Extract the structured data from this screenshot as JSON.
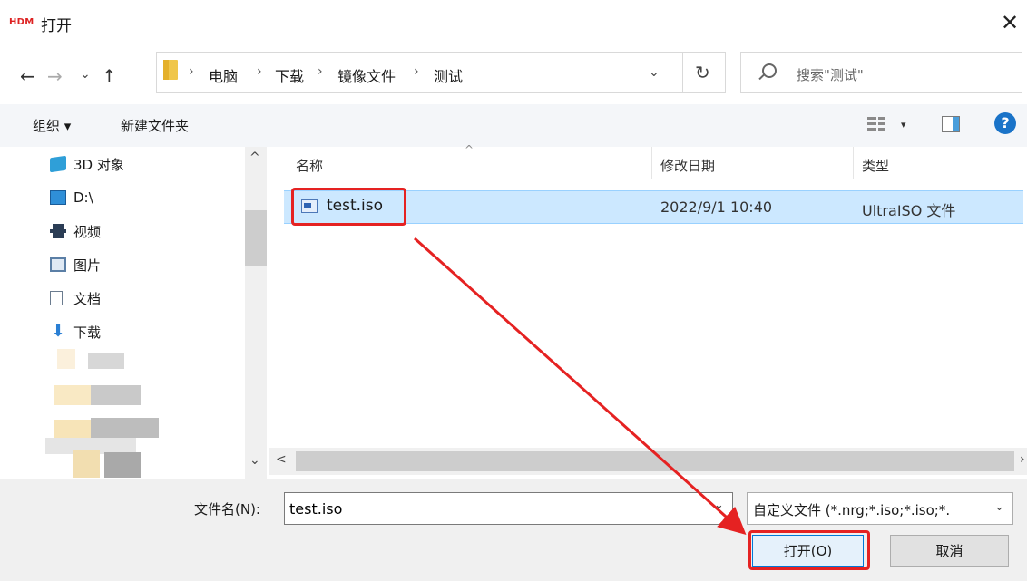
{
  "title_bar": {
    "logo_text": "HDM",
    "title": "打开",
    "close_glyph": "✕"
  },
  "nav": {
    "back": "←",
    "forward": "→",
    "recent": "⌄",
    "up": "↑"
  },
  "address": {
    "crumbs": [
      "电脑",
      "下载",
      "镜像文件",
      "测试"
    ],
    "separator": "›",
    "dropdown": "⌄",
    "refresh": "↻"
  },
  "search": {
    "placeholder": "搜索\"测试\""
  },
  "toolbar": {
    "organize_label": "组织 ▾",
    "new_folder_label": "新建文件夹",
    "view_dropdown": "▾",
    "help": "?"
  },
  "nav_pane": {
    "items": [
      {
        "label": "3D 对象",
        "icon": "3d-objects-icon"
      },
      {
        "label": "D:\\",
        "icon": "drive-icon"
      },
      {
        "label": "视频",
        "icon": "video-icon"
      },
      {
        "label": "图片",
        "icon": "pictures-icon"
      },
      {
        "label": "文档",
        "icon": "documents-icon"
      },
      {
        "label": "下载",
        "icon": "downloads-icon"
      }
    ],
    "scroll_up": "^",
    "scroll_down": "⌄"
  },
  "file_list": {
    "columns": {
      "name": "名称",
      "modified": "修改日期",
      "type": "类型"
    },
    "sort_arrow": "^",
    "files": [
      {
        "name": "test.iso",
        "modified": "2022/9/1 10:40",
        "type": "UltraISO 文件",
        "selected": true
      }
    ],
    "scroll_left": "<",
    "scroll_right": "›"
  },
  "bottom": {
    "filename_label": "文件名(N):",
    "filename_value": "test.iso",
    "filename_dropdown": "⌄",
    "filter_value": "自定义文件 (*.nrg;*.iso;*.iso;*.",
    "filter_dropdown": "⌄",
    "open_label": "打开(O)",
    "cancel_label": "取消"
  },
  "colors": {
    "selection": "#cce8ff",
    "annotation_red": "#e52222",
    "accent": "#0078d7"
  }
}
